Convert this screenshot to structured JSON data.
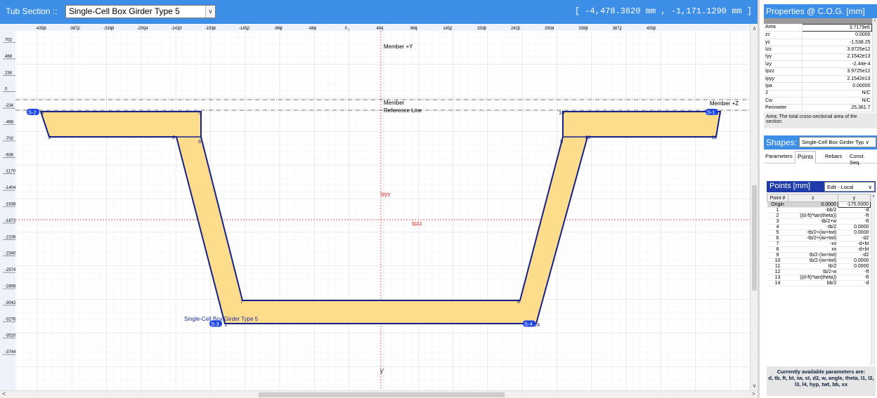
{
  "toolbar": {
    "label": "Tub Section ::",
    "section_value": "Single-Cell Box Girder Type 5",
    "coordinates": "[ -4,478.3620 mm , -1,171.1290 mm ]"
  },
  "canvas": {
    "x_ticks": [
      "-4356",
      "-3872",
      "-3388",
      "-2904",
      "-2420",
      "-1936",
      "-1452",
      "-968",
      "-484",
      "0",
      "484",
      "968",
      "1452",
      "1936",
      "2420",
      "2904",
      "3388",
      "3872",
      "4356"
    ],
    "y_ticks": [
      "702",
      "468",
      "234",
      "0",
      "-234",
      "-468",
      "-702",
      "-936",
      "-1170",
      "-1404",
      "-1638",
      "-1872",
      "-2106",
      "-2340",
      "-2574",
      "-2808",
      "-3042",
      "-3276",
      "-3510",
      "-3744"
    ],
    "labels": {
      "member_y": "Member +Y",
      "member_ref_1": "Member",
      "member_ref_2": "Reference Line",
      "member_z": "Member +Z",
      "ipyy": "Ipyy",
      "ipzz": "Ipzz",
      "y_prime": "y'",
      "shape_name": "Single-Cell Box Girder Type 5"
    },
    "stress_points": [
      "S-2",
      "S-1",
      "S-3",
      "S-4"
    ],
    "point_numbers": [
      "1",
      "2",
      "3",
      "4",
      "5",
      "6",
      "7",
      "8",
      "9",
      "10",
      "11",
      "12",
      "13",
      "14"
    ],
    "colors": {
      "fill": "#fddc8c",
      "outline": "#15208a",
      "axis": "#e02020",
      "badge": "#1c46e6"
    }
  },
  "properties": {
    "title": "Properties @ C.O.G. [mm]",
    "rows": [
      {
        "key": "Area",
        "value": "3.7179e6"
      },
      {
        "key": "zc",
        "value": "0.0000"
      },
      {
        "key": "yc",
        "value": "-1,538.25"
      },
      {
        "key": "Izz",
        "value": "3.9725e12"
      },
      {
        "key": "Iyy",
        "value": "2.1542e13"
      },
      {
        "key": "Izy",
        "value": "-2.44e-4"
      },
      {
        "key": "Ipzz",
        "value": "3.9725e12"
      },
      {
        "key": "Ipyy",
        "value": "2.1542e13"
      },
      {
        "key": "Ipa",
        "value": "0.00000"
      },
      {
        "key": "J",
        "value": "N/C"
      },
      {
        "key": "Cw",
        "value": "N/C"
      },
      {
        "key": "Perimeter",
        "value": "25,361.7"
      }
    ],
    "description": "Area: The total cross-sectional area of the section."
  },
  "shapes": {
    "label": "Shapes:",
    "selected": "Single-Cell Box Girder Typ",
    "tabs": [
      "Parameters",
      "Points",
      "Rebars",
      "Const. Seq."
    ]
  },
  "points": {
    "title": "Points [mm]",
    "mode": "Edit - Local",
    "headers": [
      "Point #",
      "z",
      "y"
    ],
    "rows": [
      [
        "Origin",
        "0.0000",
        "-175.0000"
      ],
      [
        "1",
        "-bb/2",
        "-d"
      ],
      [
        "2",
        "((d-ft)*tan(theta))",
        "-ft"
      ],
      [
        "3",
        "-tb/2+w",
        "-ft"
      ],
      [
        "4",
        "-tb/2",
        "0.0000"
      ],
      [
        "5",
        "-tb/2+(iw+twt)",
        "0.0000"
      ],
      [
        "6",
        "-tb/2+(iw+twt)",
        "-d2"
      ],
      [
        "7",
        "-xx",
        "-d+bt"
      ],
      [
        "8",
        "xx",
        "-d+bt"
      ],
      [
        "9",
        "tb/2-(iw+twt)",
        "-d2"
      ],
      [
        "10",
        "tb/2-(iw+twt)",
        "0.0000"
      ],
      [
        "11",
        "tb/2",
        "0.0000"
      ],
      [
        "12",
        "tb/2-w",
        "-ft"
      ],
      [
        "13",
        "((d-ft)*tan(theta))",
        "-ft"
      ],
      [
        "14",
        "bb/2",
        "-d"
      ]
    ],
    "params_title": "Currently available parameters are:",
    "params_list": "d, tb, ft, bt, iw, st, d2, w, angle, theta, l1, l2, l3, l4, hyp, twt, bb, xx"
  }
}
